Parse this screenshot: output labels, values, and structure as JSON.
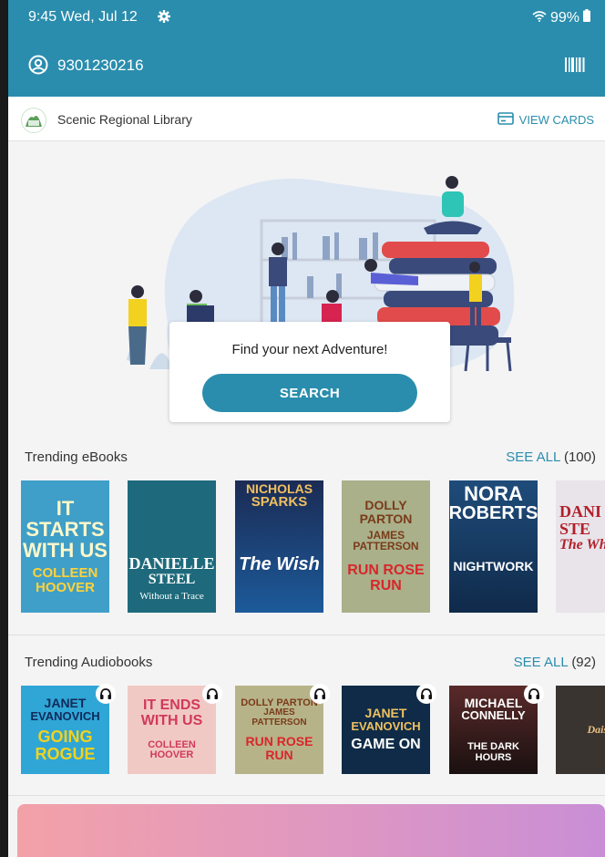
{
  "status_bar": {
    "time": "9:45  Wed, Jul 12",
    "battery": "99%"
  },
  "account": {
    "card_number": "9301230216"
  },
  "library": {
    "name": "Scenic Regional Library",
    "view_cards": "VIEW CARDS"
  },
  "hero": {
    "prompt": "Find your next Adventure!",
    "search_label": "SEARCH"
  },
  "ebooks": {
    "title": "Trending eBooks",
    "see_all": "SEE ALL",
    "count": "(100)",
    "books": [
      {
        "l1": "IT STARTS",
        "l2": "WITH US",
        "l3": "COLLEEN HOOVER",
        "bg": "#3f9fc8"
      },
      {
        "l1": "DANIELLE",
        "l2": "STEEL",
        "l3": "Without a Trace",
        "bg": "#1e6a7c"
      },
      {
        "l1": "NICHOLAS",
        "l2": "SPARKS",
        "l3": "The Wish",
        "bg": "#1c3f78"
      },
      {
        "l1": "DOLLY PARTON",
        "l2": "JAMES PATTERSON",
        "l3": "RUN ROSE RUN",
        "bg": "#a9b08a"
      },
      {
        "l1": "NORA",
        "l2": "ROBERTS",
        "l3": "NIGHTWORK",
        "bg": "#1f4c7a"
      },
      {
        "l1": "DANI",
        "l2": "STE",
        "l3": "The Whit",
        "bg": "#e8e4ea"
      }
    ]
  },
  "audiobooks": {
    "title": "Trending Audiobooks",
    "see_all": "SEE ALL",
    "count": "(92)",
    "books": [
      {
        "l1": "JANET",
        "l2": "EVANOVICH",
        "l3": "GOING ROGUE",
        "bg": "#2fa6d6"
      },
      {
        "l1": "IT ENDS",
        "l2": "WITH US",
        "l3": "COLLEEN HOOVER",
        "bg": "#f1c9c4"
      },
      {
        "l1": "DOLLY PARTON",
        "l2": "JAMES PATTERSON",
        "l3": "RUN ROSE RUN",
        "bg": "#b7b389"
      },
      {
        "l1": "JANET",
        "l2": "EVANOVICH",
        "l3": "GAME ON",
        "bg": "#0f2b47"
      },
      {
        "l1": "MICHAEL",
        "l2": "CONNELLY",
        "l3": "THE DARK HOURS",
        "bg": "#3a2222"
      },
      {
        "l1": "Daisy",
        "l2": "",
        "l3": "",
        "bg": "#3a3430"
      }
    ]
  },
  "colors": {
    "accent": "#2a8dad"
  }
}
